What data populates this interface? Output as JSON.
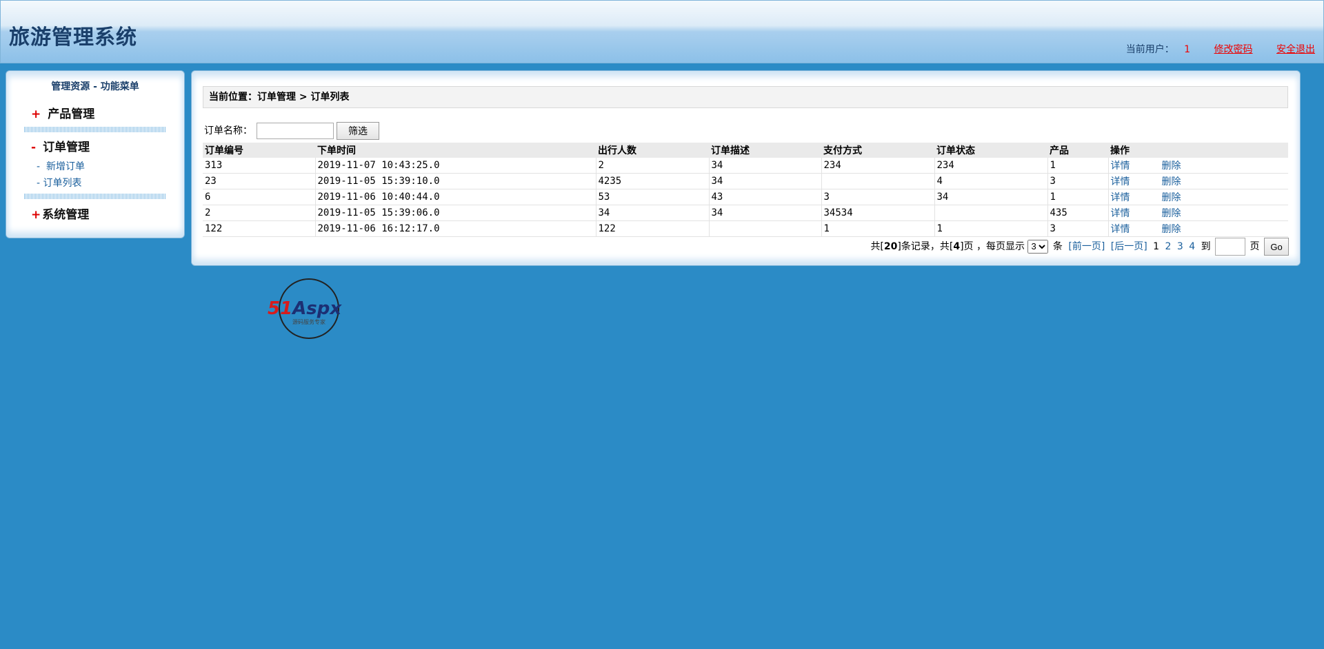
{
  "header": {
    "app_title": "旅游管理系统",
    "current_user_label": "当前用户：",
    "current_user": "1",
    "change_password": "修改密码",
    "logout": "安全退出"
  },
  "sidebar": {
    "title": "管理资源 - 功能菜单",
    "groups": [
      {
        "sign": "+",
        "label": "产品管理"
      },
      {
        "sign": "-",
        "label": "订单管理"
      },
      {
        "sign": "+",
        "label": "系统管理"
      }
    ],
    "order_items": [
      {
        "prefix": "-",
        "label": "新增订单"
      },
      {
        "prefix": "-",
        "label": "订单列表"
      }
    ]
  },
  "main": {
    "breadcrumb": "当前位置：订单管理 > 订单列表",
    "filter_label": "订单名称：",
    "filter_value": "",
    "filter_button": "筛选",
    "columns": [
      "订单编号",
      "下单时间",
      "出行人数",
      "订单描述",
      "支付方式",
      "订单状态",
      "产品",
      "操作"
    ],
    "rows": [
      [
        "313",
        "2019-11-07 10:43:25.0",
        "2",
        "34",
        "234",
        "234",
        "1"
      ],
      [
        "23",
        "2019-11-05 15:39:10.0",
        "4235",
        "34",
        "",
        "4",
        "3"
      ],
      [
        "6",
        "2019-11-06 10:40:44.0",
        "53",
        "43",
        "3",
        "34",
        "1"
      ],
      [
        "2",
        "2019-11-05 15:39:06.0",
        "34",
        "34",
        "34534",
        "",
        "435"
      ],
      [
        "122",
        "2019-11-06 16:12:17.0",
        "122",
        "",
        "1",
        "1",
        "3"
      ]
    ],
    "action_detail": "详情",
    "action_delete": "删除"
  },
  "pager": {
    "summary_prefix": "共[",
    "total_records": "20",
    "summary_mid": "]条记录，共[",
    "total_pages": "4",
    "summary_suffix": "]页 ，每页显示",
    "page_size": "3",
    "unit": "条",
    "prev": "[前一页]",
    "next": "[后一页]",
    "current_page": "1",
    "pages": [
      "2",
      "3",
      "4"
    ],
    "goto_label": "到",
    "goto_value": "",
    "page_unit": "页",
    "go_button": "Go"
  },
  "logo": {
    "text": "51Aspx",
    "tagline": "源码服务专家"
  },
  "colors": {
    "background": "#2b8bc6",
    "title": "#1a3f6a",
    "link": "#1a5f9c",
    "alert": "#e00000"
  }
}
